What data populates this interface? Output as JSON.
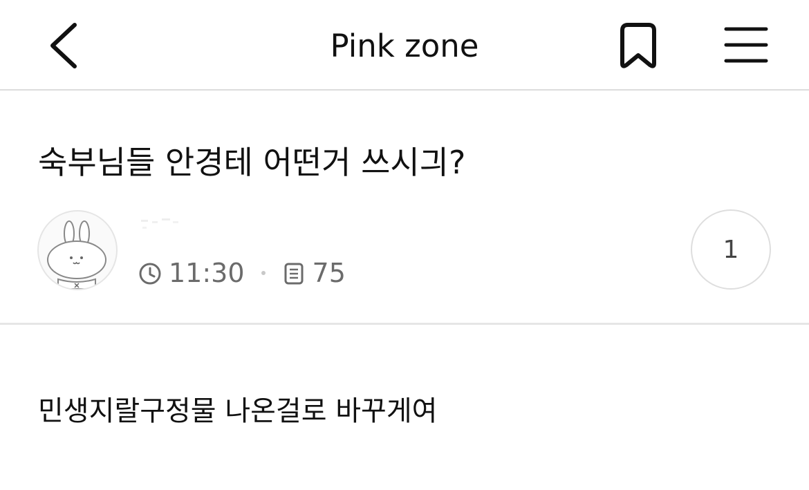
{
  "header": {
    "title": "Pink zone",
    "back_icon": "chevron-left-icon",
    "bookmark_icon": "bookmark-icon",
    "menu_icon": "hamburger-menu-icon"
  },
  "post": {
    "title": "숙부님들 안경테 어떤거 쓰시긔?",
    "author_avatar": "rabbit-avatar",
    "time": "11:30",
    "views": "75",
    "comment_count": "1",
    "body": "민생지랄구정물 나온걸로 바꾸게여"
  },
  "colors": {
    "text": "#111111",
    "meta_text": "#6b6b6b",
    "divider": "#e6e6e6"
  }
}
